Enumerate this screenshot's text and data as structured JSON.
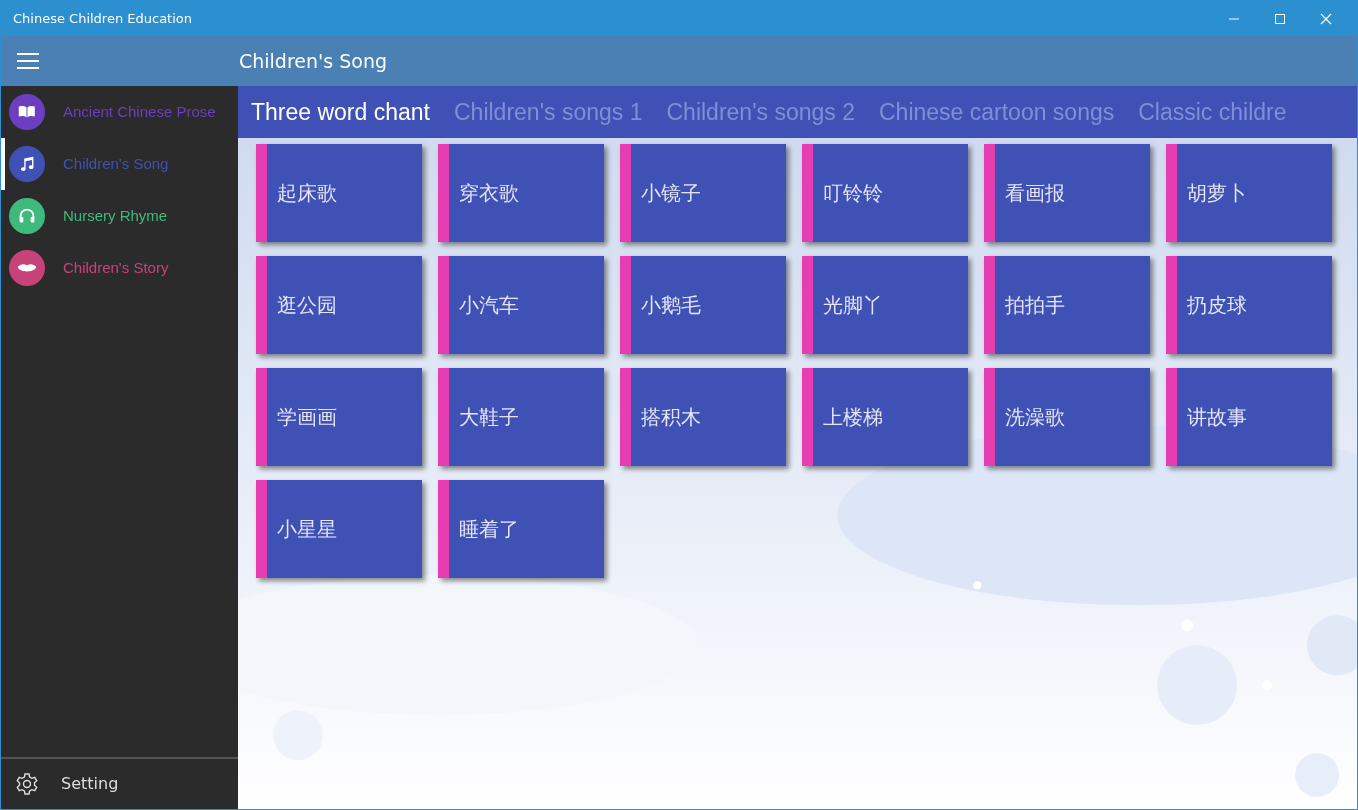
{
  "window": {
    "title": "Chinese Children Education",
    "controls": [
      {
        "kind": "minimize"
      },
      {
        "kind": "maximize"
      },
      {
        "kind": "close"
      }
    ]
  },
  "header": {
    "title": "Children's Song"
  },
  "sidebar": {
    "items": [
      {
        "label": "Ancient Chinese Prose",
        "kind": "book",
        "color": "#6b3fbf",
        "selected": false
      },
      {
        "label": "Children's Song",
        "kind": "music",
        "color": "#3f51b5",
        "selected": true
      },
      {
        "label": "Nursery Rhyme",
        "kind": "headphones",
        "color": "#3dba7c",
        "selected": false
      },
      {
        "label": "Children's Story",
        "kind": "lips",
        "color": "#c8427a",
        "selected": false
      }
    ],
    "footer": {
      "label": "Setting"
    }
  },
  "tabs": [
    {
      "label": "Three word chant",
      "selected": true
    },
    {
      "label": "Children's songs 1",
      "selected": false
    },
    {
      "label": "Children's songs 2",
      "selected": false
    },
    {
      "label": "Chinese cartoon songs",
      "selected": false
    },
    {
      "label": "Classic childre",
      "selected": false
    }
  ],
  "songs": [
    "起床歌",
    "穿衣歌",
    "小镜子",
    "叮铃铃",
    "看画报",
    "胡萝卜",
    "逛公园",
    "小汽车",
    "小鹅毛",
    "光脚丫",
    "拍拍手",
    "扔皮球",
    "学画画",
    "大鞋子",
    "搭积木",
    "上楼梯",
    "洗澡歌",
    "讲故事",
    "小星星",
    "睡着了"
  ]
}
